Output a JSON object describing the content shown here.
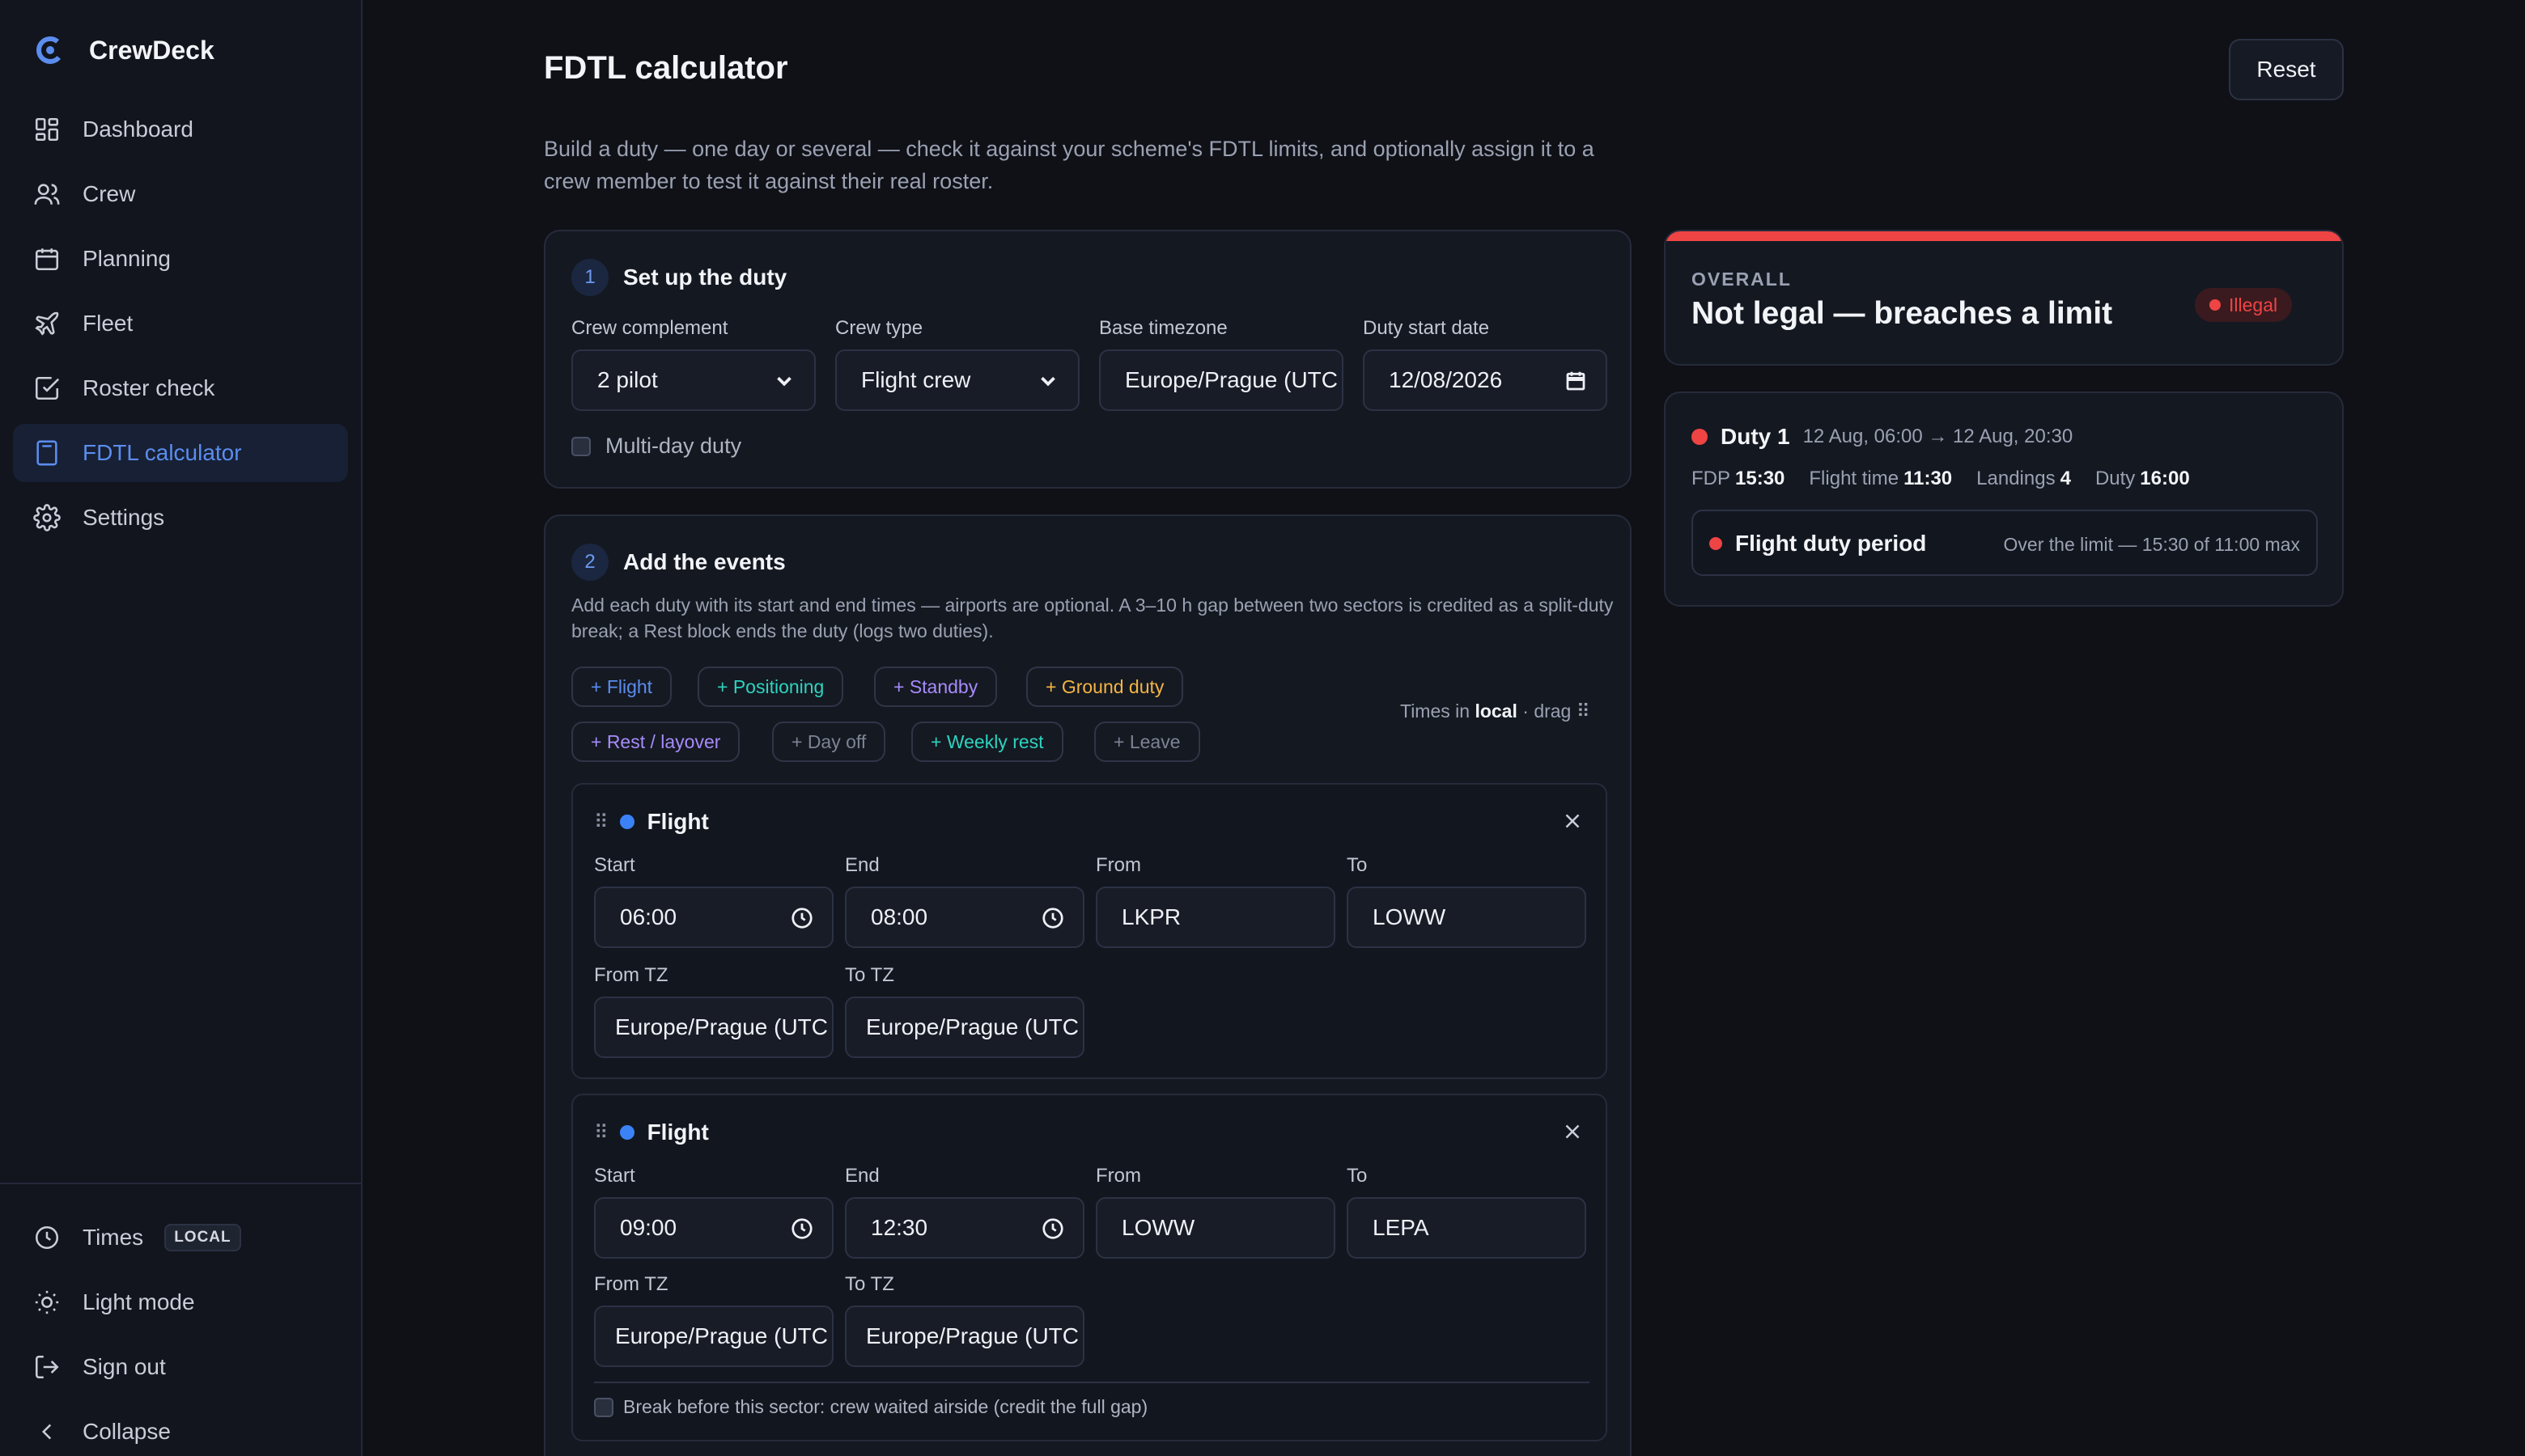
{
  "app": {
    "name": "CrewDeck"
  },
  "sidebar": {
    "items": [
      {
        "label": "Dashboard",
        "icon": "dashboard-icon"
      },
      {
        "label": "Crew",
        "icon": "users-icon"
      },
      {
        "label": "Planning",
        "icon": "calendar-icon"
      },
      {
        "label": "Fleet",
        "icon": "plane-icon"
      },
      {
        "label": "Roster check",
        "icon": "check-square-icon"
      },
      {
        "label": "FDTL calculator",
        "icon": "calculator-icon",
        "active": true
      },
      {
        "label": "Settings",
        "icon": "gear-icon"
      }
    ],
    "bottom": {
      "times_label": "Times",
      "times_badge": "LOCAL",
      "light_mode": "Light mode",
      "sign_out": "Sign out",
      "collapse": "Collapse"
    }
  },
  "page": {
    "title": "FDTL calculator",
    "reset_label": "Reset",
    "intro": "Build a duty — one day or several — check it against your scheme's FDTL limits, and optionally assign it to a crew member to test it against their real roster."
  },
  "setup": {
    "step": "1",
    "title": "Set up the duty",
    "crew_complement_label": "Crew complement",
    "crew_complement_value": "2 pilot",
    "crew_type_label": "Crew type",
    "crew_type_value": "Flight crew",
    "base_tz_label": "Base timezone",
    "base_tz_value": "Europe/Prague (UTC",
    "start_date_label": "Duty start date",
    "start_date_value": "12/08/2026",
    "multi_day_label": "Multi-day duty"
  },
  "events": {
    "step": "2",
    "title": "Add the events",
    "description": "Add each duty with its start and end times — airports are optional. A 3–10 h gap between two sectors is credited as a split-duty break; a Rest block ends the duty (logs two duties).",
    "chips": {
      "flight": "+ Flight",
      "positioning": "+ Positioning",
      "standby": "+ Standby",
      "ground": "+ Ground duty",
      "rest": "+ Rest / layover",
      "dayoff": "+ Day off",
      "weekly": "+ Weekly rest",
      "leave": "+ Leave"
    },
    "times_prefix": "Times in",
    "times_mode": "local",
    "times_suffix": "· drag ⠿",
    "labels": {
      "start": "Start",
      "end": "End",
      "from": "From",
      "to": "To",
      "from_tz": "From TZ",
      "to_tz": "To TZ"
    },
    "list": [
      {
        "type": "Flight",
        "start": "06:00",
        "end": "08:00",
        "from": "LKPR",
        "to": "LOWW",
        "from_tz": "Europe/Prague (UTC",
        "to_tz": "Europe/Prague (UTC"
      },
      {
        "type": "Flight",
        "start": "09:00",
        "end": "12:30",
        "from": "LOWW",
        "to": "LEPA",
        "from_tz": "Europe/Prague (UTC",
        "to_tz": "Europe/Prague (UTC",
        "break_label": "Break before this sector: crew waited airside (credit the full gap)"
      }
    ]
  },
  "result": {
    "overall_label": "OVERALL",
    "overall_title": "Not legal — breaches a limit",
    "badge": "Illegal",
    "duty": {
      "name": "Duty 1",
      "range": "12 Aug, 06:00 → 12 Aug, 20:30",
      "fdp_label": "FDP",
      "fdp_value": "15:30",
      "flight_time_label": "Flight time",
      "flight_time_value": "11:30",
      "landings_label": "Landings",
      "landings_value": "4",
      "duty_label": "Duty",
      "duty_value": "16:00",
      "check_name": "Flight duty period",
      "check_msg": "Over the limit — 15:30 of 11:00 max"
    }
  },
  "colors": {
    "accent": "#5b8def",
    "flight_dot": "#3b82f6",
    "illegal": "#ef4444"
  }
}
